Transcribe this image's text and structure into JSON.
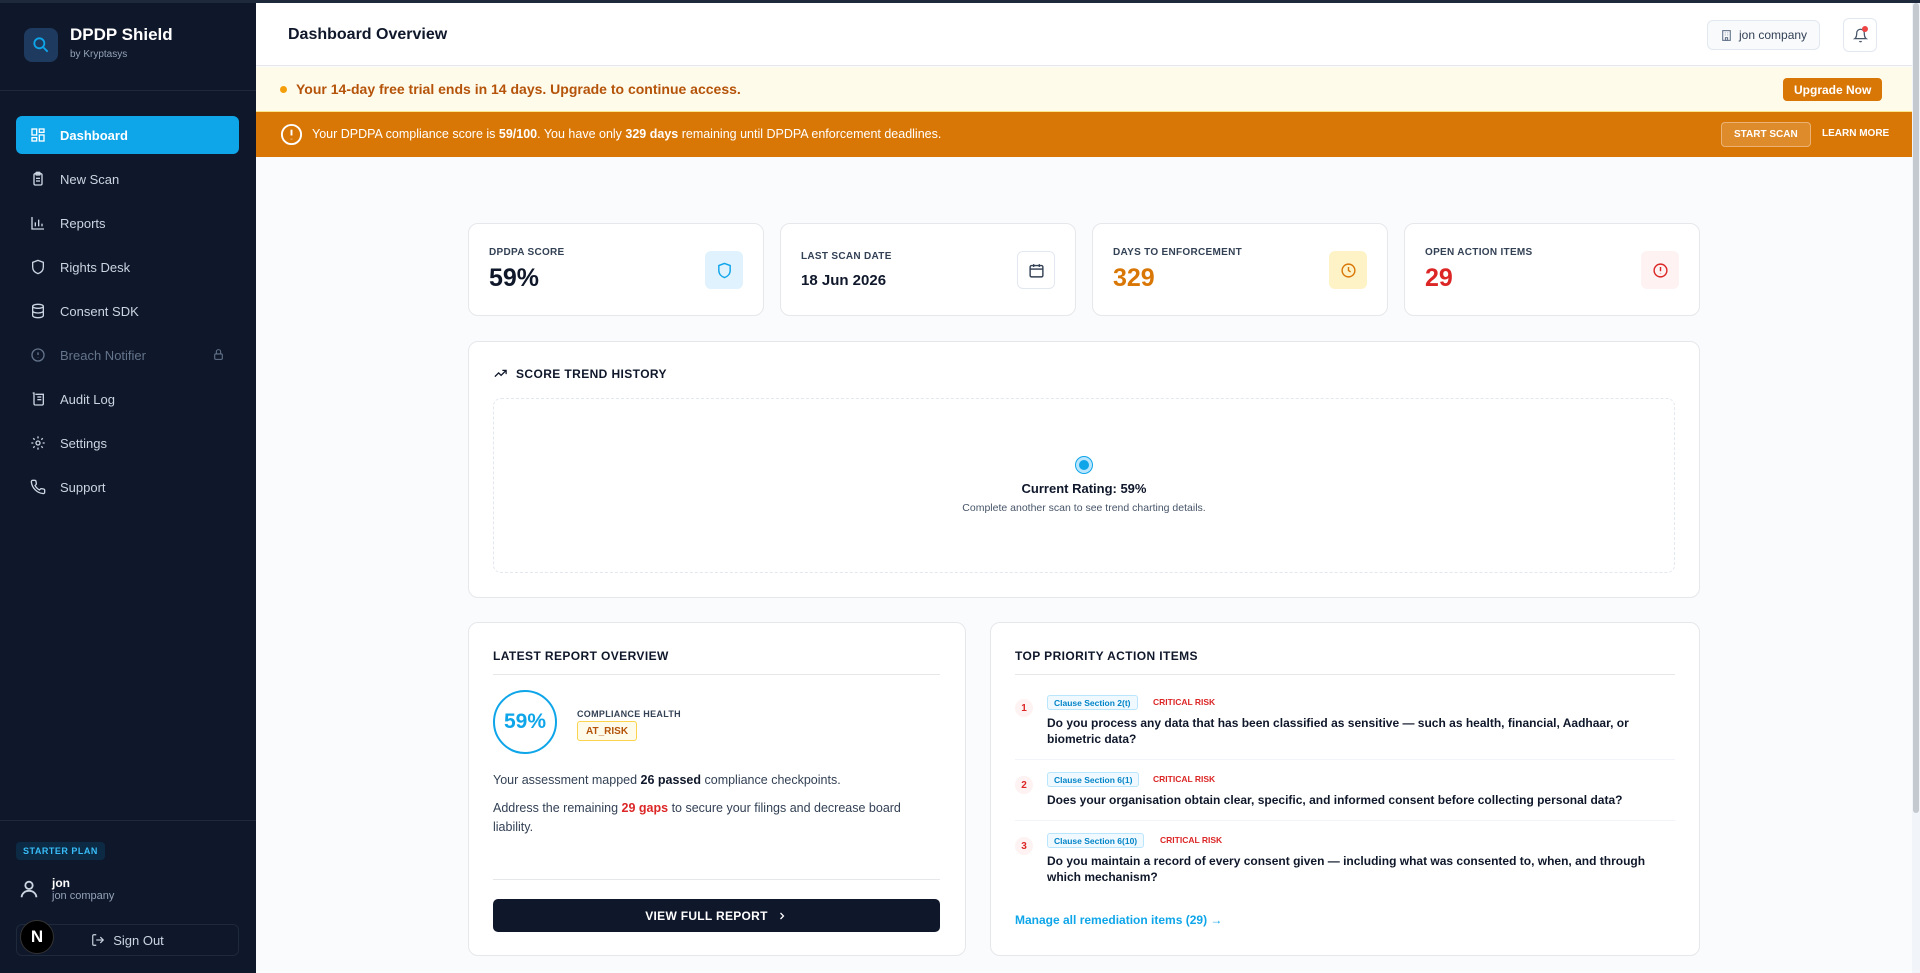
{
  "brand": {
    "title": "DPDP Shield",
    "subtitle": "by Kryptasys"
  },
  "sidebar": {
    "items": [
      {
        "label": "Dashboard",
        "icon": "dashboard-icon",
        "active": true
      },
      {
        "label": "New Scan",
        "icon": "clipboard-icon"
      },
      {
        "label": "Reports",
        "icon": "bar-chart-icon"
      },
      {
        "label": "Rights Desk",
        "icon": "shield-icon"
      },
      {
        "label": "Consent SDK",
        "icon": "database-icon"
      },
      {
        "label": "Breach Notifier",
        "icon": "alert-circle-icon",
        "locked": true
      },
      {
        "label": "Audit Log",
        "icon": "scroll-icon"
      },
      {
        "label": "Settings",
        "icon": "gear-icon"
      },
      {
        "label": "Support",
        "icon": "phone-icon"
      }
    ],
    "plan": "STARTER PLAN",
    "user": {
      "name": "jon",
      "company": "jon company"
    },
    "signout": "Sign Out",
    "n_badge": "N"
  },
  "header": {
    "title": "Dashboard Overview",
    "company": "jon company"
  },
  "trial": {
    "text": "Your 14-day free trial ends in 14 days. Upgrade to continue access.",
    "button": "Upgrade Now"
  },
  "alert": {
    "prefix": "Your DPDPA compliance score is ",
    "score": "59/100",
    "middle": ". You have only ",
    "days": "329 days",
    "suffix": " remaining until DPDPA enforcement deadlines.",
    "start_scan": "START SCAN",
    "learn_more": "LEARN MORE"
  },
  "stats": [
    {
      "label": "DPDPA SCORE",
      "value": "59%",
      "icon": "shield-icon",
      "color": "#0f172a"
    },
    {
      "label": "LAST SCAN DATE",
      "value": "18 Jun 2026",
      "icon": "calendar-icon",
      "color": "#0f172a"
    },
    {
      "label": "DAYS TO ENFORCEMENT",
      "value": "329",
      "icon": "clock-icon",
      "color": "#d97706"
    },
    {
      "label": "OPEN ACTION ITEMS",
      "value": "29",
      "icon": "alert-circle-icon",
      "color": "#dc2626"
    }
  ],
  "trend": {
    "title": "SCORE TREND HISTORY",
    "rating": "Current Rating: 59%",
    "hint": "Complete another scan to see trend charting details."
  },
  "report": {
    "title": "LATEST REPORT OVERVIEW",
    "score": "59%",
    "health_label": "COMPLIANCE HEALTH",
    "status": "AT_RISK",
    "p1_pre": "Your assessment mapped ",
    "p1_bold": "26 passed",
    "p1_post": " compliance checkpoints.",
    "p2_pre": "Address the remaining ",
    "p2_red": "29 gaps",
    "p2_post": " to secure your filings and decrease board liability.",
    "button": "VIEW FULL REPORT"
  },
  "actions": {
    "title": "TOP PRIORITY ACTION ITEMS",
    "items": [
      {
        "num": "1",
        "clause": "Clause Section 2(t)",
        "risk": "CRITICAL RISK",
        "question": "Do you process any data that has been classified as sensitive — such as health, financial, Aadhaar, or biometric data?"
      },
      {
        "num": "2",
        "clause": "Clause Section 6(1)",
        "risk": "CRITICAL RISK",
        "question": "Does your organisation obtain clear, specific, and informed consent before collecting personal data?"
      },
      {
        "num": "3",
        "clause": "Clause Section 6(10)",
        "risk": "CRITICAL RISK",
        "question": "Do you maintain a record of every consent given — including what was consented to, when, and through which mechanism?"
      }
    ],
    "manage_link": "Manage all remediation items (29) →"
  },
  "colors": {
    "accent": "#0ea5e9",
    "warning": "#d97706",
    "danger": "#dc2626",
    "sidebar": "#0f172a"
  }
}
